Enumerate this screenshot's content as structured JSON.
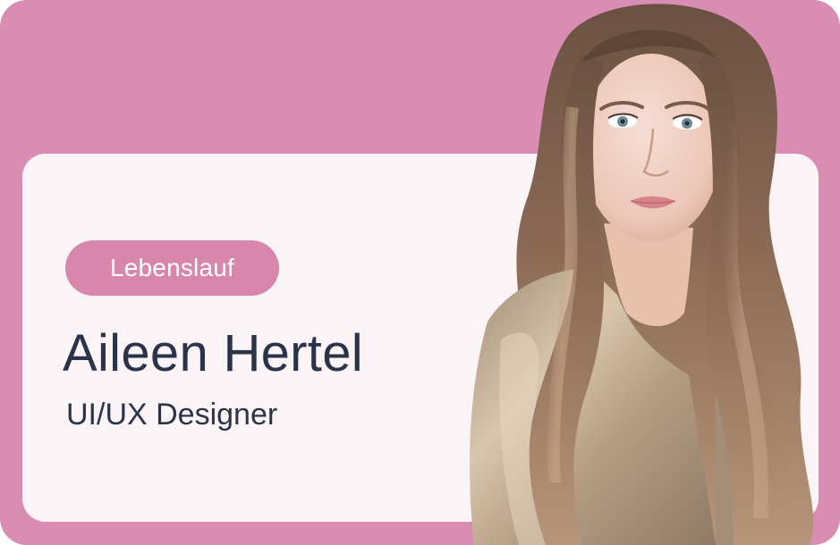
{
  "cv": {
    "badge_label": "Lebenslauf",
    "name": "Aileen Hertel",
    "role": "UI/UX Designer"
  },
  "colors": {
    "card_background": "#da8db2",
    "panel_background": "#fbf4f7",
    "badge_background": "#d986ad",
    "text_dark": "#2a3348"
  },
  "portrait": {
    "icon": "person-photo"
  }
}
